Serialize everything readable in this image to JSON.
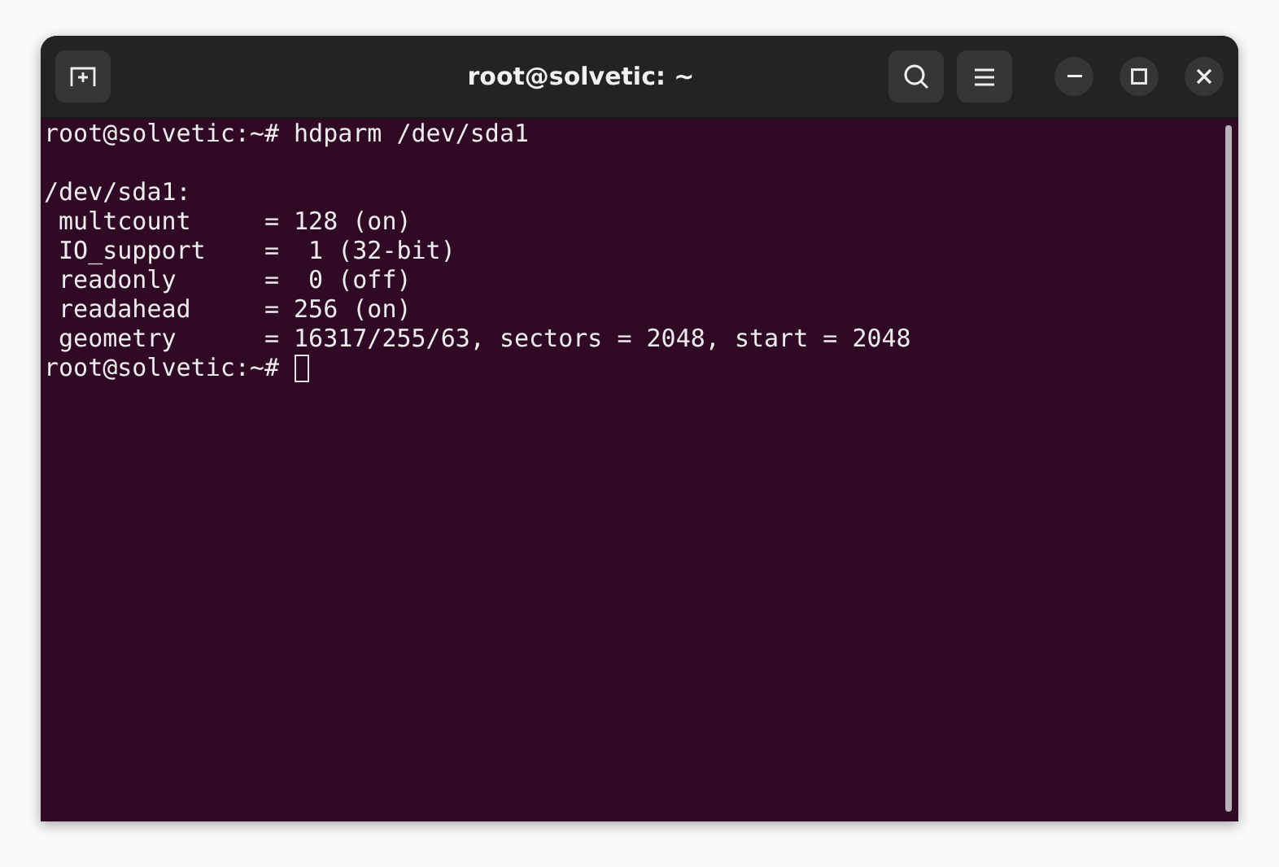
{
  "window": {
    "title": "root@solvetic: ~"
  },
  "terminal": {
    "lines": [
      {
        "kind": "text",
        "text": "root@solvetic:~# hdparm /dev/sda1"
      },
      {
        "kind": "blank"
      },
      {
        "kind": "text",
        "text": "/dev/sda1:"
      },
      {
        "kind": "text",
        "text": " multcount     = 128 (on)"
      },
      {
        "kind": "text",
        "text": " IO_support    =  1 (32-bit)"
      },
      {
        "kind": "text",
        "text": " readonly      =  0 (off)"
      },
      {
        "kind": "text",
        "text": " readahead     = 256 (on)"
      },
      {
        "kind": "text",
        "text": " geometry      = 16317/255/63, sectors = 2048, start = 2048"
      },
      {
        "kind": "prompt",
        "text": "root@solvetic:~#",
        "cursor": true
      }
    ]
  }
}
